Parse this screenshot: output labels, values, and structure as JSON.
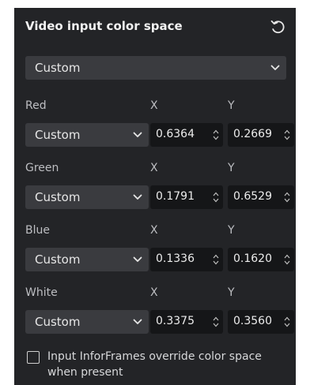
{
  "title": "Video input color space",
  "icons": {
    "reset": "reset-arrow-icon",
    "dropdown": "chevron-down-icon",
    "spinner": "spinner-arrows-icon"
  },
  "main_select": {
    "value": "Custom"
  },
  "axis_x": "X",
  "axis_y": "Y",
  "rows": [
    {
      "label": "Red",
      "select": "Custom",
      "x": "0.6364",
      "y": "0.2669"
    },
    {
      "label": "Green",
      "select": "Custom",
      "x": "0.1791",
      "y": "0.6529"
    },
    {
      "label": "Blue",
      "select": "Custom",
      "x": "0.1336",
      "y": "0.1620"
    },
    {
      "label": "White",
      "select": "Custom",
      "x": "0.3375",
      "y": "0.3560"
    }
  ],
  "checkbox": {
    "label": "Input InforFrames override color space when present",
    "checked": false
  },
  "colors": {
    "panel_bg": "#232427",
    "select_bg": "#3a3b3f",
    "field_bg": "#151618"
  }
}
